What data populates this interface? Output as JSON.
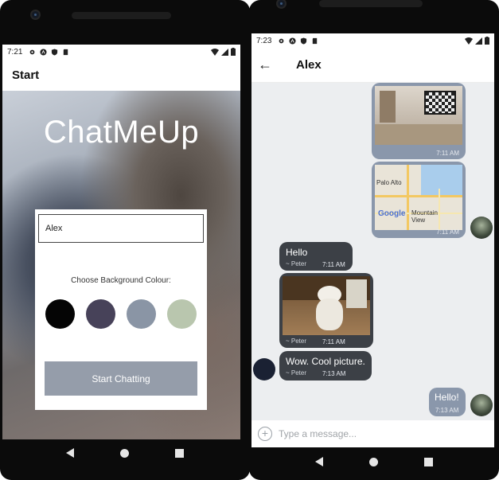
{
  "left_phone": {
    "status": {
      "time": "7:21"
    },
    "appbar": {
      "title": "Start"
    },
    "app_title": "ChatMeUp",
    "name_input": {
      "value": "Alex"
    },
    "background_label": "Choose Background Colour:",
    "swatches": [
      {
        "name": "black",
        "color": "#050505"
      },
      {
        "name": "dark-purple",
        "color": "#474259"
      },
      {
        "name": "slate-blue",
        "color": "#8a95a5"
      },
      {
        "name": "sage-green",
        "color": "#b9c6ae"
      }
    ],
    "start_button": {
      "label": "Start Chatting",
      "color": "#959daa"
    }
  },
  "right_phone": {
    "status": {
      "time": "7:23"
    },
    "appbar": {
      "title": "Alex"
    },
    "messages": [
      {
        "side": "right",
        "type": "image",
        "content": "room-photo",
        "time": "7:11 AM"
      },
      {
        "side": "right",
        "type": "map",
        "time": "7:11 AM",
        "map_labels": {
          "city1": "Palo Alto",
          "city2": "Mountain View",
          "brand": "Google"
        }
      },
      {
        "side": "left",
        "type": "text",
        "text": "Hello",
        "sender": "~ Peter",
        "time": "7:11 AM"
      },
      {
        "side": "left",
        "type": "image",
        "content": "dog-photo",
        "sender": "~ Peter",
        "time": "7:11 AM"
      },
      {
        "side": "left",
        "type": "text",
        "text": "Wow. Cool picture.",
        "sender": "~ Peter",
        "time": "7:13 AM"
      },
      {
        "side": "right",
        "type": "text",
        "text": "Hello!",
        "time": "7:13 AM"
      }
    ],
    "composer": {
      "placeholder": "Type a message..."
    },
    "colors": {
      "bubble_right": "#8a97ab",
      "bubble_left": "#3c4046",
      "chat_background": "#eceef0"
    }
  }
}
